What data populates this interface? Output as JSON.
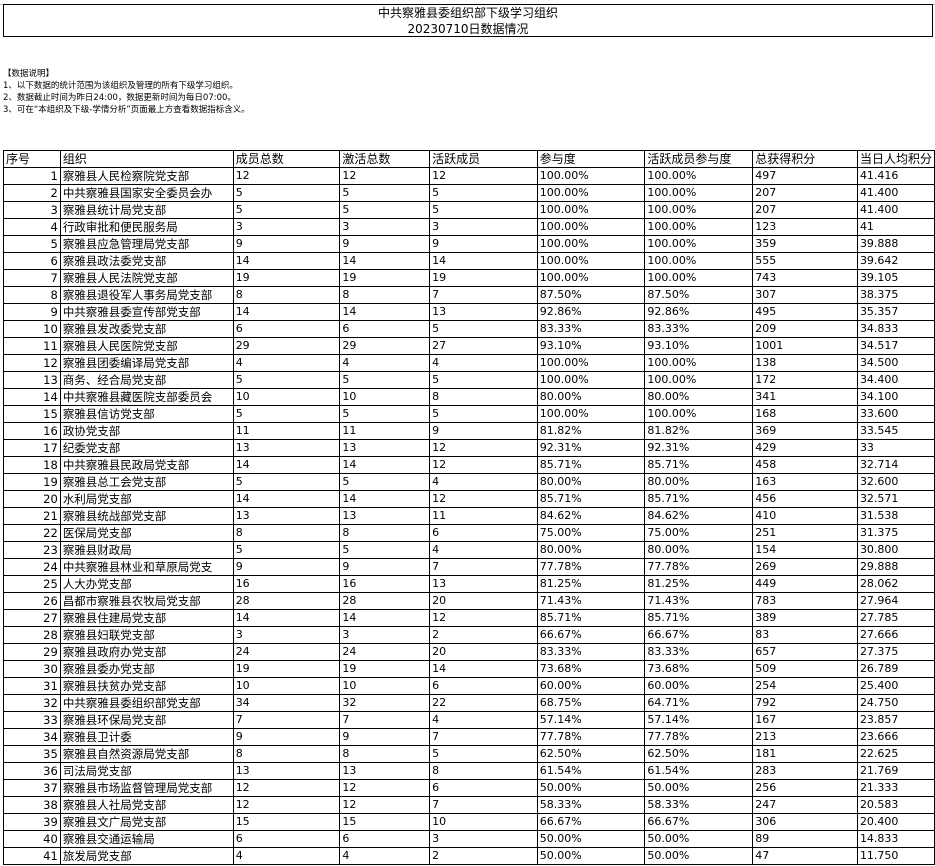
{
  "title": "中共察雅县委组织部下级学习组织",
  "subtitle": "20230710日数据情况",
  "notes": [
    "【数据说明】",
    "1、以下数据的统计范围为该组织及管理的所有下级学习组织。",
    "2、数据截止时间为昨日24:00，数据更新时间为每日07:00。",
    "3、可在“本组织及下级-学情分析”页面最上方查看数据指标含义。"
  ],
  "headers": [
    "序号",
    "组织",
    "成员总数",
    "激活总数",
    "活跃成员",
    "参与度",
    "活跃成员参与度",
    "总获得积分",
    "当日人均积分"
  ],
  "rows": [
    [
      "1",
      "察雅县人民检察院党支部",
      "12",
      "12",
      "12",
      "100.00%",
      "100.00%",
      "497",
      "41.416"
    ],
    [
      "2",
      "中共察雅县国家安全委员会办",
      "5",
      "5",
      "5",
      "100.00%",
      "100.00%",
      "207",
      "41.400"
    ],
    [
      "3",
      "察雅县统计局党支部",
      "5",
      "5",
      "5",
      "100.00%",
      "100.00%",
      "207",
      "41.400"
    ],
    [
      "4",
      "行政审批和便民服务局",
      "3",
      "3",
      "3",
      "100.00%",
      "100.00%",
      "123",
      "41"
    ],
    [
      "5",
      "察雅县应急管理局党支部",
      "9",
      "9",
      "9",
      "100.00%",
      "100.00%",
      "359",
      "39.888"
    ],
    [
      "6",
      "察雅县政法委党支部",
      "14",
      "14",
      "14",
      "100.00%",
      "100.00%",
      "555",
      "39.642"
    ],
    [
      "7",
      "察雅县人民法院党支部",
      "19",
      "19",
      "19",
      "100.00%",
      "100.00%",
      "743",
      "39.105"
    ],
    [
      "8",
      "察雅县退役军人事务局党支部",
      "8",
      "8",
      "7",
      "87.50%",
      "87.50%",
      "307",
      "38.375"
    ],
    [
      "9",
      "中共察雅县委宣传部党支部",
      "14",
      "14",
      "13",
      "92.86%",
      "92.86%",
      "495",
      "35.357"
    ],
    [
      "10",
      "察雅县发改委党支部",
      "6",
      "6",
      "5",
      "83.33%",
      "83.33%",
      "209",
      "34.833"
    ],
    [
      "11",
      "察雅县人民医院党支部",
      "29",
      "29",
      "27",
      "93.10%",
      "93.10%",
      "1001",
      "34.517"
    ],
    [
      "12",
      "察雅县团委编译局党支部",
      "4",
      "4",
      "4",
      "100.00%",
      "100.00%",
      "138",
      "34.500"
    ],
    [
      "13",
      "商务、经合局党支部",
      "5",
      "5",
      "5",
      "100.00%",
      "100.00%",
      "172",
      "34.400"
    ],
    [
      "14",
      "中共察雅县藏医院支部委员会",
      "10",
      "10",
      "8",
      "80.00%",
      "80.00%",
      "341",
      "34.100"
    ],
    [
      "15",
      "察雅县信访党支部",
      "5",
      "5",
      "5",
      "100.00%",
      "100.00%",
      "168",
      "33.600"
    ],
    [
      "16",
      "政协党支部",
      "11",
      "11",
      "9",
      "81.82%",
      "81.82%",
      "369",
      "33.545"
    ],
    [
      "17",
      "纪委党支部",
      "13",
      "13",
      "12",
      "92.31%",
      "92.31%",
      "429",
      "33"
    ],
    [
      "18",
      "中共察雅县民政局党支部",
      "14",
      "14",
      "12",
      "85.71%",
      "85.71%",
      "458",
      "32.714"
    ],
    [
      "19",
      "察雅县总工会党支部",
      "5",
      "5",
      "4",
      "80.00%",
      "80.00%",
      "163",
      "32.600"
    ],
    [
      "20",
      "水利局党支部",
      "14",
      "14",
      "12",
      "85.71%",
      "85.71%",
      "456",
      "32.571"
    ],
    [
      "21",
      "察雅县统战部党支部",
      "13",
      "13",
      "11",
      "84.62%",
      "84.62%",
      "410",
      "31.538"
    ],
    [
      "22",
      "医保局党支部",
      "8",
      "8",
      "6",
      "75.00%",
      "75.00%",
      "251",
      "31.375"
    ],
    [
      "23",
      "察雅县财政局",
      "5",
      "5",
      "4",
      "80.00%",
      "80.00%",
      "154",
      "30.800"
    ],
    [
      "24",
      "中共察雅县林业和草原局党支",
      "9",
      "9",
      "7",
      "77.78%",
      "77.78%",
      "269",
      "29.888"
    ],
    [
      "25",
      "人大办党支部",
      "16",
      "16",
      "13",
      "81.25%",
      "81.25%",
      "449",
      "28.062"
    ],
    [
      "26",
      "昌都市察雅县农牧局党支部",
      "28",
      "28",
      "20",
      "71.43%",
      "71.43%",
      "783",
      "27.964"
    ],
    [
      "27",
      "察雅县住建局党支部",
      "14",
      "14",
      "12",
      "85.71%",
      "85.71%",
      "389",
      "27.785"
    ],
    [
      "28",
      "察雅县妇联党支部",
      "3",
      "3",
      "2",
      "66.67%",
      "66.67%",
      "83",
      "27.666"
    ],
    [
      "29",
      "察雅县政府办党支部",
      "24",
      "24",
      "20",
      "83.33%",
      "83.33%",
      "657",
      "27.375"
    ],
    [
      "30",
      "察雅县委办党支部",
      "19",
      "19",
      "14",
      "73.68%",
      "73.68%",
      "509",
      "26.789"
    ],
    [
      "31",
      "察雅县扶贫办党支部",
      "10",
      "10",
      "6",
      "60.00%",
      "60.00%",
      "254",
      "25.400"
    ],
    [
      "32",
      "中共察雅县委组织部党支部",
      "34",
      "32",
      "22",
      "68.75%",
      "64.71%",
      "792",
      "24.750"
    ],
    [
      "33",
      "察雅县环保局党支部",
      "7",
      "7",
      "4",
      "57.14%",
      "57.14%",
      "167",
      "23.857"
    ],
    [
      "34",
      "察雅县卫计委",
      "9",
      "9",
      "7",
      "77.78%",
      "77.78%",
      "213",
      "23.666"
    ],
    [
      "35",
      "察雅县自然资源局党支部",
      "8",
      "8",
      "5",
      "62.50%",
      "62.50%",
      "181",
      "22.625"
    ],
    [
      "36",
      "司法局党支部",
      "13",
      "13",
      "8",
      "61.54%",
      "61.54%",
      "283",
      "21.769"
    ],
    [
      "37",
      "察雅县市场监督管理局党支部",
      "12",
      "12",
      "6",
      "50.00%",
      "50.00%",
      "256",
      "21.333"
    ],
    [
      "38",
      "察雅县人社局党支部",
      "12",
      "12",
      "7",
      "58.33%",
      "58.33%",
      "247",
      "20.583"
    ],
    [
      "39",
      "察雅县文广局党支部",
      "15",
      "15",
      "10",
      "66.67%",
      "66.67%",
      "306",
      "20.400"
    ],
    [
      "40",
      "察雅县交通运输局",
      "6",
      "6",
      "3",
      "50.00%",
      "50.00%",
      "89",
      "14.833"
    ],
    [
      "41",
      "旅发局党支部",
      "4",
      "4",
      "2",
      "50.00%",
      "50.00%",
      "47",
      "11.750"
    ]
  ]
}
